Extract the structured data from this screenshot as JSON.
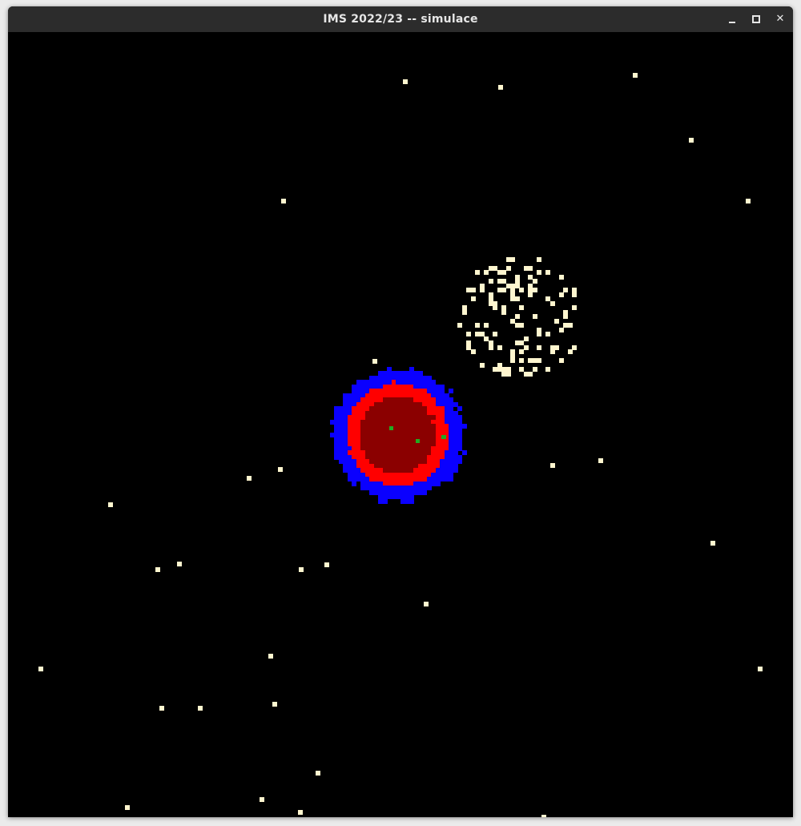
{
  "window": {
    "title": "IMS 2022/23 -- simulace",
    "buttons": {
      "minimize_icon": "minimize-icon",
      "maximize_icon": "maximize-icon",
      "close_icon": "close-icon",
      "close_glyph": "✕"
    }
  },
  "simulation": {
    "colors": {
      "background": "#000000",
      "particle": "#fff6cf",
      "outer_layer": "#0a00ff",
      "middle_layer": "#ff0000",
      "core": "#8b0000",
      "marker": "#22aa22"
    }
  }
}
